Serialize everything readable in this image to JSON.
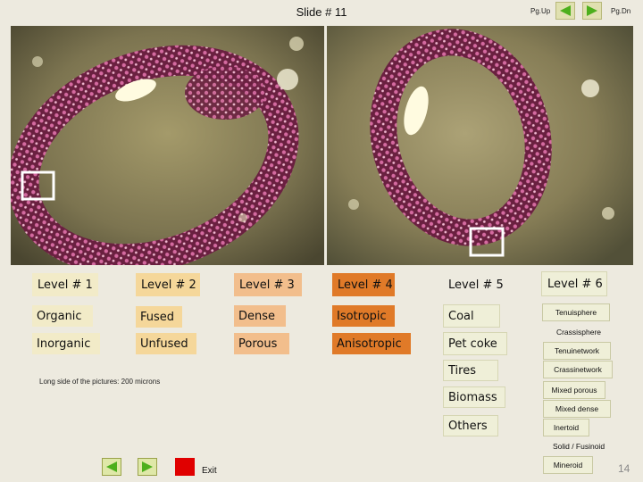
{
  "header": {
    "title": "Slide # 11",
    "pgup_label": "Pg.Up",
    "pgdn_label": "Pg.Dn"
  },
  "levels": {
    "headers": [
      "Level # 1",
      "Level # 2",
      "Level # 3",
      "Level # 4",
      "Level # 5",
      "Level # 6"
    ],
    "level1": [
      "Organic",
      "Inorganic"
    ],
    "level2": [
      "Fused",
      "Unfused"
    ],
    "level3": [
      "Dense",
      "Porous"
    ],
    "level4": [
      "Isotropic",
      "Anisotropic"
    ],
    "level5": [
      "Coal",
      "Pet coke",
      "Tires",
      "Biomass",
      "Others"
    ],
    "level6": [
      "Tenuisphere",
      "Crassisphere",
      "Tenuinetwork",
      "Crassinetwork",
      "Mixed porous",
      "Mixed dense",
      "Inertoid",
      "Solid / Fusinoid",
      "Mineroid"
    ]
  },
  "note": "Long side of the pictures: 200 microns",
  "footer": {
    "exit_label": "Exit",
    "page_number": "14"
  },
  "colors": {
    "background": "#edeadf",
    "level1": "#f2ebc8",
    "level2": "#f5d79a",
    "level3": "#f2be8c",
    "level4": "#e07a28",
    "level6_box": "#efefd8",
    "nav_arrow": "#4caf1c",
    "exit_red": "#e00000"
  }
}
